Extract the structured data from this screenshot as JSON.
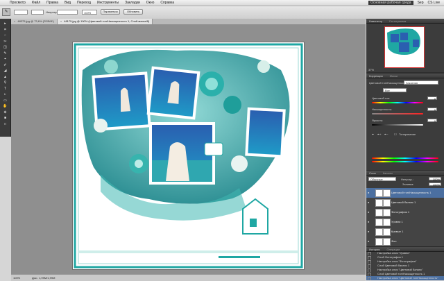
{
  "menubar": {
    "apple": "",
    "items": [
      "Просмотр",
      "Файл",
      "Правка",
      "Вид",
      "Переход",
      "Инструменты",
      "Закладки",
      "Окно",
      "Справка"
    ],
    "right": [
      "Основная рабочая среда",
      "Sep",
      "CS Live"
    ]
  },
  "options": {
    "size_value": "",
    "mode_value": "",
    "opacity_label": "Непрозр.:",
    "opacity_value": "",
    "zoom_value": "100%",
    "btn1": "Параметры",
    "btn2": "Обновить",
    "workspace": "Основная рабочая среда"
  },
  "tabs": [
    {
      "label": "48375.jpg @ 73,6% (RGB/8*)",
      "active": false
    },
    {
      "label": "48175.jpg @ 100% (Цветовой тон/Насыщенность 1, Слой-маска/8)",
      "active": true
    }
  ],
  "toolbar": {
    "tools": [
      "▸",
      "⌗",
      "◌",
      "✂",
      "◫",
      "✎",
      "⌖",
      "✐",
      "◢",
      "▲",
      "⚲",
      "T",
      "▹",
      "▭",
      "✋",
      "⊕",
      "■",
      "□"
    ]
  },
  "status": {
    "zoom": "100%",
    "doc": "Док.: 1,99M/1,99M"
  },
  "panels": {
    "navigator": {
      "title": "Навигатор",
      "tab2": "Гистограмма",
      "zoom": "37%"
    },
    "adjust": {
      "title": "Коррекция",
      "tab2": "Маски",
      "preset": "Цветовой тон/Насыщенность",
      "preset2": "Заказная",
      "channel": "Все",
      "hue_label": "Цветовой тон:",
      "hue_value": "0",
      "sat_label": "Насыщенность:",
      "sat_value": "0",
      "light_label": "Яркость:",
      "light_value": "0",
      "colorize_label": "Тонирование"
    },
    "layers": {
      "title": "Слои",
      "tab2": "Каналы",
      "blend": "Обычные",
      "opacity_label": "Непрозр.:",
      "opacity_value": "100%",
      "fill_label": "Заливка:",
      "fill_value": "100%",
      "items": [
        {
          "name": "Цветовой тон/Насыщенность 1",
          "selected": true
        },
        {
          "name": "Цветовой баланс 1",
          "selected": false
        },
        {
          "name": "Фотография 1",
          "selected": false
        },
        {
          "name": "Уровни 1",
          "selected": false
        },
        {
          "name": "Кривые 1",
          "selected": false
        },
        {
          "name": "Фон",
          "selected": false
        }
      ]
    },
    "history": {
      "title": "История",
      "tab2": "Операции",
      "items": [
        {
          "name": "Открыть",
          "selected": false
        },
        {
          "name": "Слой Кривые 1",
          "selected": false
        },
        {
          "name": "Настройка слоя \"Кривые\"",
          "selected": false
        },
        {
          "name": "Слой Уровни 1",
          "selected": false
        },
        {
          "name": "Настройка слоя \"Уровни\"",
          "selected": false
        },
        {
          "name": "Слой Фотография 1",
          "selected": false
        },
        {
          "name": "Настройка слоя \"Фотография\"",
          "selected": false
        },
        {
          "name": "Слой Цветовой баланс 1",
          "selected": false
        },
        {
          "name": "Настройка слоя \"Цветовой баланс\"",
          "selected": false
        },
        {
          "name": "Слой Цветовой тон/Насыщенность 1",
          "selected": false
        },
        {
          "name": "Настройка слоя \"Цветовой тон/Насыщенность\"",
          "selected": true
        }
      ]
    }
  },
  "colors": {
    "teal": "#1fa7a3",
    "deep_teal": "#0c7e83",
    "sky": "#1c63b8",
    "selected": "#4b6fa0"
  }
}
